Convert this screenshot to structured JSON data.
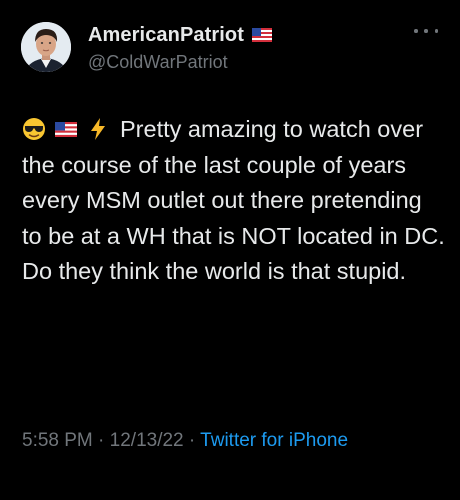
{
  "author": {
    "display_name": "AmericanPatriot",
    "handle": "@ColdWarPatriot",
    "flag_icon": "us-flag-icon"
  },
  "tweet": {
    "emojis": [
      "smiling-face-with-sunglasses-icon",
      "us-flag-icon",
      "high-voltage-icon"
    ],
    "text": "Pretty amazing to watch over the course of the last couple of years every MSM  outlet out there pretending to be at a WH that is NOT located in DC. Do they think the world is that stupid."
  },
  "meta": {
    "time": "5:58 PM",
    "separator": "·",
    "date": "12/13/22",
    "source": "Twitter for iPhone"
  },
  "colors": {
    "background": "#000000",
    "text": "#e7e9ea",
    "secondary": "#71767b",
    "link": "#1d9bf0"
  }
}
